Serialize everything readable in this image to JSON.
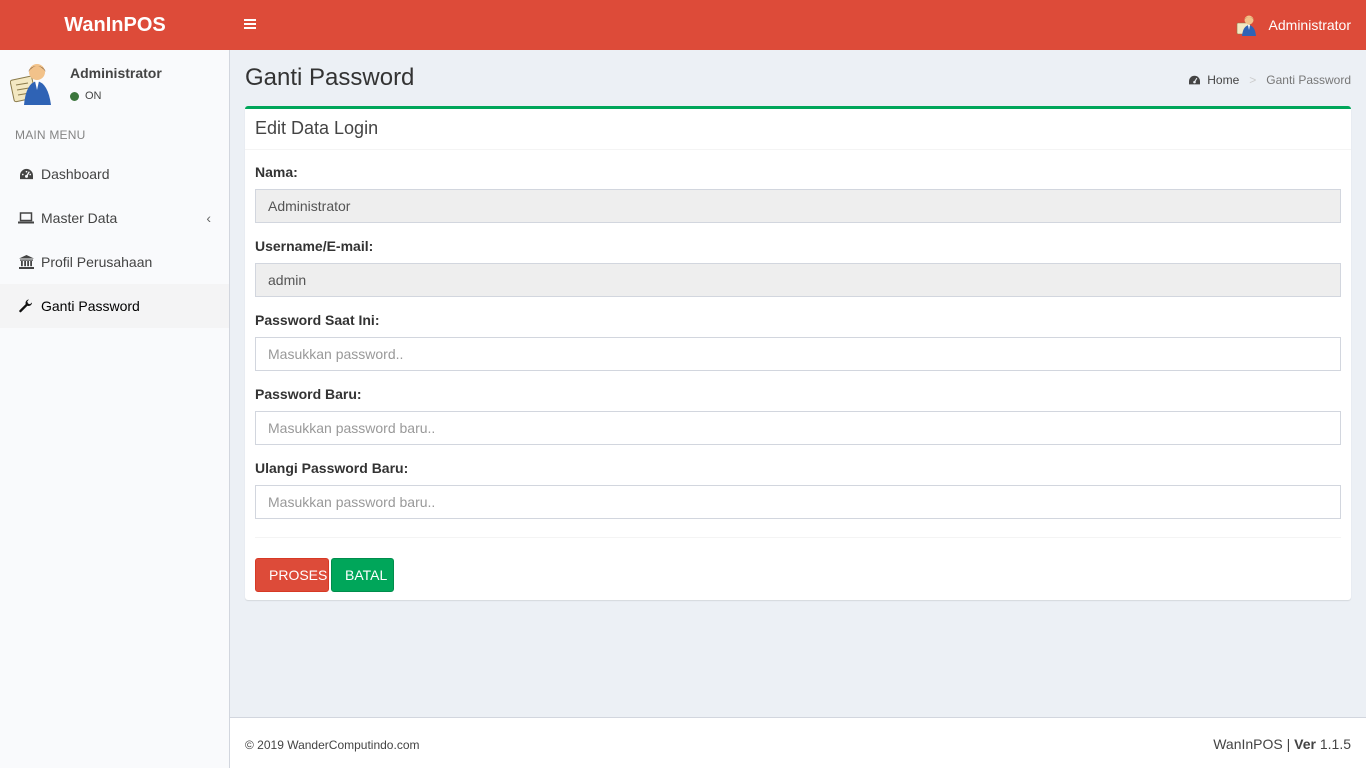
{
  "header": {
    "brand": "WanInPOS",
    "user_name": "Administrator"
  },
  "sidebar": {
    "user_name": "Administrator",
    "user_status": "ON",
    "menu_header": "MAIN MENU",
    "items": [
      {
        "label": "Dashboard",
        "icon": "dashboard-icon"
      },
      {
        "label": "Master Data",
        "icon": "laptop-icon"
      },
      {
        "label": "Profil Perusahaan",
        "icon": "bank-icon"
      },
      {
        "label": "Ganti Password",
        "icon": "wrench-icon",
        "active": true
      }
    ]
  },
  "page": {
    "title": "Ganti Password",
    "breadcrumb": {
      "home": "Home",
      "current": "Ganti Password"
    }
  },
  "form": {
    "box_title": "Edit Data Login",
    "fields": [
      {
        "label": "Nama:",
        "value": "Administrator",
        "placeholder": ""
      },
      {
        "label": "Username/E-mail:",
        "value": "admin",
        "placeholder": ""
      },
      {
        "label": "Password Saat Ini:",
        "value": "",
        "placeholder": "Masukkan password.."
      },
      {
        "label": "Password Baru:",
        "value": "",
        "placeholder": "Masukkan password baru.."
      },
      {
        "label": "Ulangi Password Baru:",
        "value": "",
        "placeholder": "Masukkan password baru.."
      }
    ],
    "submit_label": "PROSES",
    "cancel_label": "BATAL"
  },
  "footer": {
    "copyright": "© 2019  WanderComputindo.com",
    "app_name": "WanInPOS |",
    "version_label": "Ver",
    "version": "1.1.5"
  },
  "colors": {
    "header": "#dd4b39",
    "box_top_border": "#00a65a",
    "danger": "#dd4b39",
    "success": "#00a65a"
  }
}
